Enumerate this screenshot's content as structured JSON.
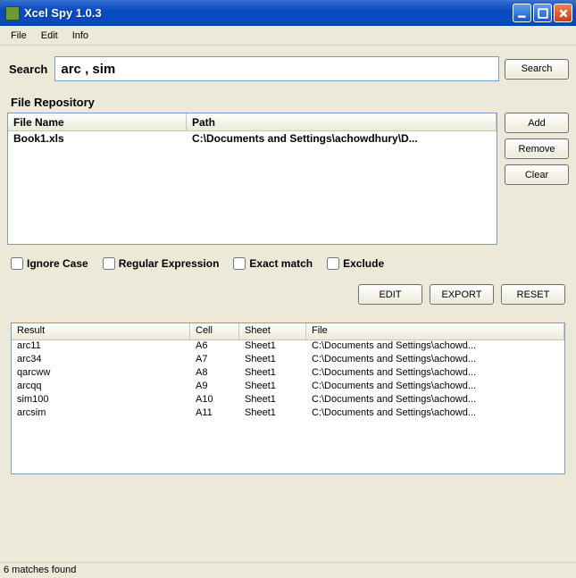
{
  "window": {
    "title": "Xcel Spy 1.0.3"
  },
  "menu": {
    "file": "File",
    "edit": "Edit",
    "info": "Info"
  },
  "search": {
    "label": "Search",
    "value": "arc , sim",
    "button": "Search"
  },
  "repo": {
    "section_label": "File Repository",
    "headers": {
      "name": "File Name",
      "path": "Path"
    },
    "rows": [
      {
        "name": "Book1.xls",
        "path": "C:\\Documents and Settings\\achowdhury\\D..."
      }
    ],
    "buttons": {
      "add": "Add",
      "remove": "Remove",
      "clear": "Clear"
    }
  },
  "options": {
    "ignore_case": "Ignore Case",
    "regex": "Regular Expression",
    "exact": "Exact match",
    "exclude": "Exclude"
  },
  "actions": {
    "edit": "EDIT",
    "export": "EXPORT",
    "reset": "RESET"
  },
  "results": {
    "headers": {
      "result": "Result",
      "cell": "Cell",
      "sheet": "Sheet",
      "file": "File"
    },
    "rows": [
      {
        "result": "arc11",
        "cell": "A6",
        "sheet": "Sheet1",
        "file": "C:\\Documents and Settings\\achowd..."
      },
      {
        "result": "arc34",
        "cell": "A7",
        "sheet": "Sheet1",
        "file": "C:\\Documents and Settings\\achowd..."
      },
      {
        "result": "qarcww",
        "cell": "A8",
        "sheet": "Sheet1",
        "file": "C:\\Documents and Settings\\achowd..."
      },
      {
        "result": "arcqq",
        "cell": "A9",
        "sheet": "Sheet1",
        "file": "C:\\Documents and Settings\\achowd..."
      },
      {
        "result": "sim100",
        "cell": "A10",
        "sheet": "Sheet1",
        "file": "C:\\Documents and Settings\\achowd..."
      },
      {
        "result": "arcsim",
        "cell": "A11",
        "sheet": "Sheet1",
        "file": "C:\\Documents and Settings\\achowd..."
      }
    ]
  },
  "status": "6 matches found"
}
